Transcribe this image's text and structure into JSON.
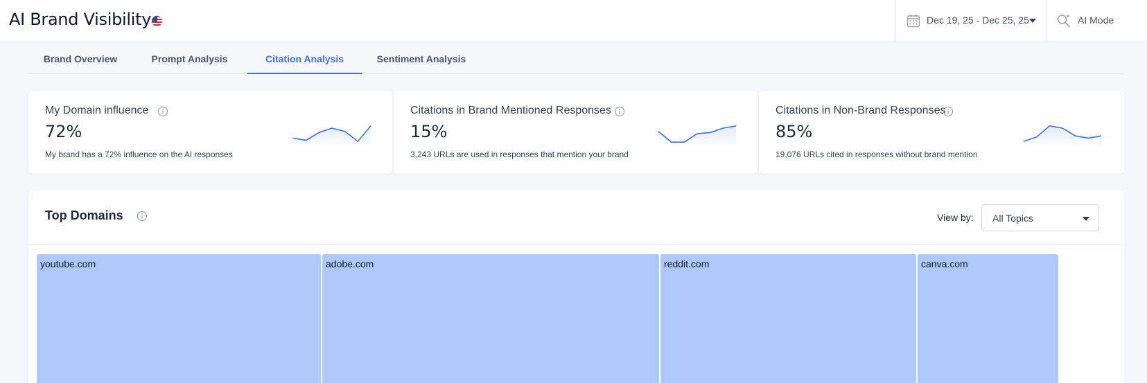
{
  "header": {
    "title": "AI Brand Visibility",
    "date_range": "Dec 19, 25 - Dec 25, 25",
    "ai_mode_label": "AI Mode"
  },
  "tabs": [
    {
      "label": "Brand Overview",
      "active": false
    },
    {
      "label": "Prompt Analysis",
      "active": false
    },
    {
      "label": "Citation Analysis",
      "active": true
    },
    {
      "label": "Sentiment Analysis",
      "active": false
    }
  ],
  "kpis": [
    {
      "title": "My Domain influence",
      "value": "72%",
      "description": "My brand has a 72% influence on the AI responses",
      "trend": [
        0.3,
        0.2,
        0.55,
        0.75,
        0.6,
        0.15,
        0.85
      ]
    },
    {
      "title": "Citations in Brand Mentioned Responses",
      "value": "15%",
      "description": "3,243 URLs are used in responses that mention your brand",
      "trend": [
        0.6,
        0.12,
        0.12,
        0.5,
        0.55,
        0.75,
        0.85
      ]
    },
    {
      "title": "Citations in Non-Brand Responses",
      "value": "85%",
      "description": "19,076 URLs cited in responses without brand mention",
      "trend": [
        0.15,
        0.35,
        0.85,
        0.75,
        0.4,
        0.3,
        0.4
      ]
    }
  ],
  "top_domains": {
    "title": "Top Domains",
    "view_by_label": "View by:",
    "view_by_value": "All Topics",
    "domains": [
      {
        "name": "youtube.com"
      },
      {
        "name": "adobe.com"
      },
      {
        "name": "reddit.com"
      },
      {
        "name": "canva.com"
      }
    ]
  },
  "colors": {
    "accent": "#3b6fe0",
    "tile": "#adc8f9",
    "sparkline": "#3b6fe0"
  }
}
